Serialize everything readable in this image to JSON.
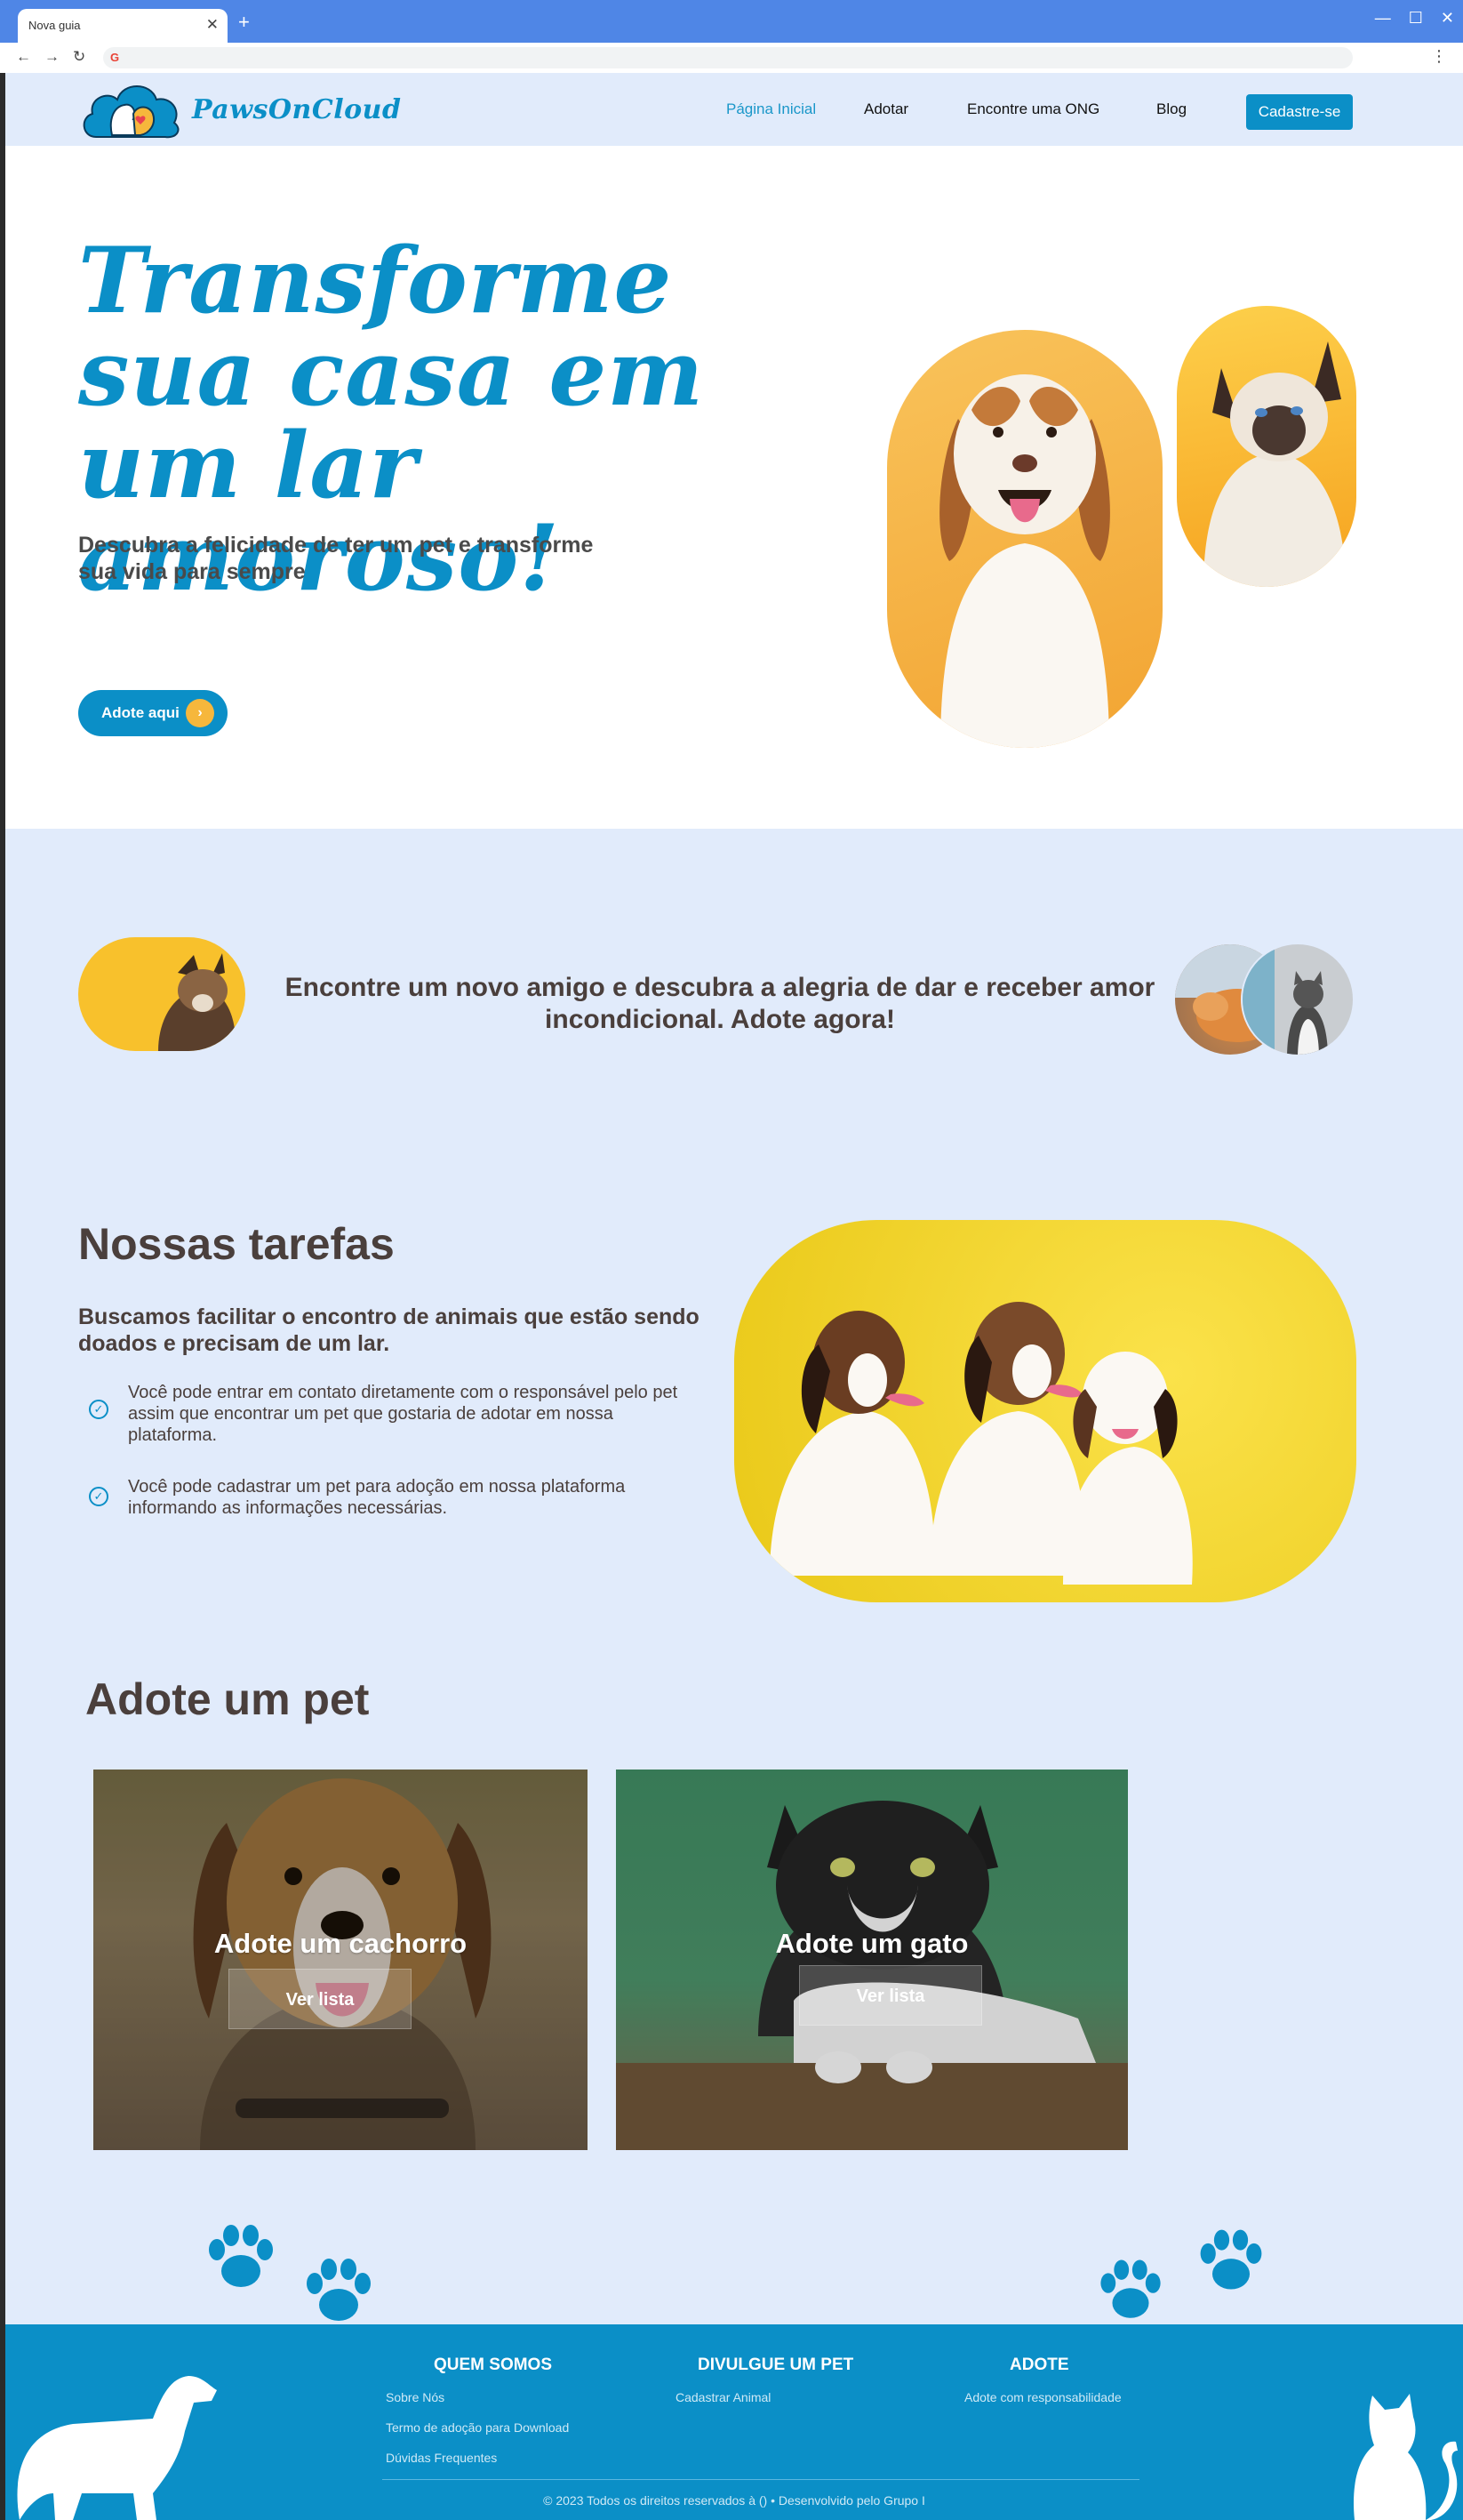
{
  "browser": {
    "tab_title": "Nova guia",
    "tab_close": "✕",
    "new_tab": "+",
    "win_min": "—",
    "win_max": "☐",
    "win_close": "✕",
    "back": "←",
    "forward": "→",
    "reload": "↻",
    "favicon": "G",
    "menu": "⋮"
  },
  "header": {
    "logo_text": "PawsOnCloud",
    "nav": [
      "Página Inicial",
      "Adotar",
      "Encontre uma ONG",
      "Blog"
    ],
    "cta": "Cadastre-se"
  },
  "hero": {
    "title": "Transforme sua casa em um lar amoroso!",
    "subtitle": "Descubra a felicidade de ter um pet e transforme sua vida para sempre",
    "button": "Adote aqui",
    "button_arrow": "›"
  },
  "band": {
    "text": "Encontre um novo amigo e descubra a alegria de dar e receber amor incondicional. Adote agora!"
  },
  "tasks": {
    "title": "Nossas tarefas",
    "lead": "Buscamos facilitar o encontro de animais que estão sendo doados e precisam de um lar.",
    "check": "✓",
    "items": [
      "Você pode entrar em contato diretamente com o responsável pelo pet assim que encontrar um pet que gostaria de adotar em nossa plataforma.",
      "Você pode cadastrar um pet para adoção em nossa plataforma informando as informações necessárias."
    ]
  },
  "adopt": {
    "title": "Adote um pet",
    "cards": [
      {
        "title": "Adote um cachorro",
        "button": "Ver lista"
      },
      {
        "title": "Adote um gato",
        "button": "Ver lista"
      }
    ]
  },
  "footer": {
    "columns": [
      {
        "heading": "QUEM SOMOS",
        "links": [
          "Sobre Nós",
          "Termo de adoção para Download",
          "Dúvidas Frequentes"
        ]
      },
      {
        "heading": "DIVULGUE UM PET",
        "links": [
          "Cadastrar Animal"
        ]
      },
      {
        "heading": "ADOTE",
        "links": [
          "Adote com responsabilidade"
        ]
      }
    ],
    "copyright": "© 2023 Todos os direitos reservados à () • Desenvolvido pelo Grupo I"
  },
  "colors": {
    "brand_blue": "#0b8fc7",
    "page_bg": "#e1ebfb",
    "accent_orange": "#f6b73c",
    "text_dark": "#4a3f3c"
  },
  "icons": [
    "back-icon",
    "forward-icon",
    "reload-icon",
    "menu-icon",
    "arrow-right-icon",
    "check-circle-icon",
    "paw-icon",
    "dog-silhouette-icon",
    "cat-silhouette-icon"
  ]
}
